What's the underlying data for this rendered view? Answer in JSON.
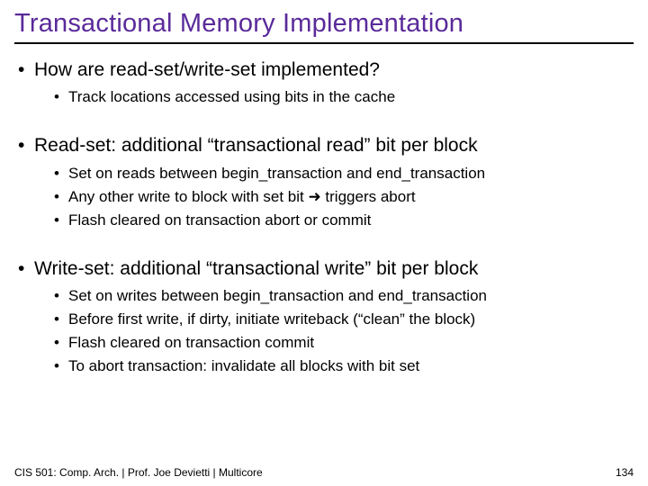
{
  "title": "Transactional Memory Implementation",
  "bullets": {
    "b1": "How are read-set/write-set implemented?",
    "b1_1": "Track locations accessed using bits in the cache",
    "b2": "Read-set: additional “transactional read” bit per block",
    "b2_1": "Set on reads between begin_transaction and end_transaction",
    "b2_2_pre": "Any other write to block with set bit ",
    "b2_2_arrow": "➜",
    "b2_2_post": " triggers abort",
    "b2_3": "Flash cleared on transaction abort or commit",
    "b3": "Write-set: additional “transactional write” bit per block",
    "b3_1": "Set on writes between begin_transaction and end_transaction",
    "b3_2": "Before first write, if dirty, initiate writeback (“clean” the block)",
    "b3_3": "Flash cleared on transaction commit",
    "b3_4": "To abort transaction: invalidate all blocks with bit set"
  },
  "footer": {
    "left": "CIS 501: Comp. Arch.  |  Prof. Joe Devietti  |  Multicore",
    "page": "134"
  }
}
